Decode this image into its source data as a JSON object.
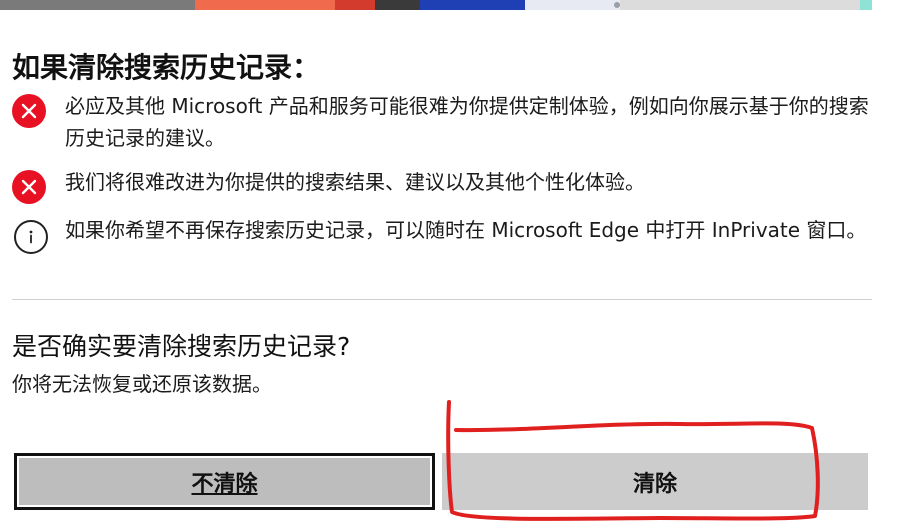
{
  "dialog": {
    "title": "如果清除搜索历史记录：",
    "warnings": [
      {
        "icon": "error-x-icon",
        "text": "必应及其他 Microsoft 产品和服务可能很难为你提供定制体验，例如向你展示基于你的搜索历史记录的建议。"
      },
      {
        "icon": "error-x-icon",
        "text": "我们将很难改进为你提供的搜索结果、建议以及其他个性化体验。"
      },
      {
        "icon": "info-icon",
        "text": "如果你希望不再保存搜索历史记录，可以随时在 Microsoft Edge 中打开 InPrivate 窗口。"
      }
    ],
    "confirm_question": "是否确实要清除搜索历史记录?",
    "confirm_subtext": "你将无法恢复或还原该数据。",
    "buttons": {
      "cancel_label": "不清除",
      "clear_label": "清除"
    }
  },
  "colors": {
    "error_icon": "#e81123",
    "annotation_stroke": "#e0201f",
    "cancel_button_bg": "#bdbdbd",
    "clear_button_bg": "#cccccc"
  }
}
